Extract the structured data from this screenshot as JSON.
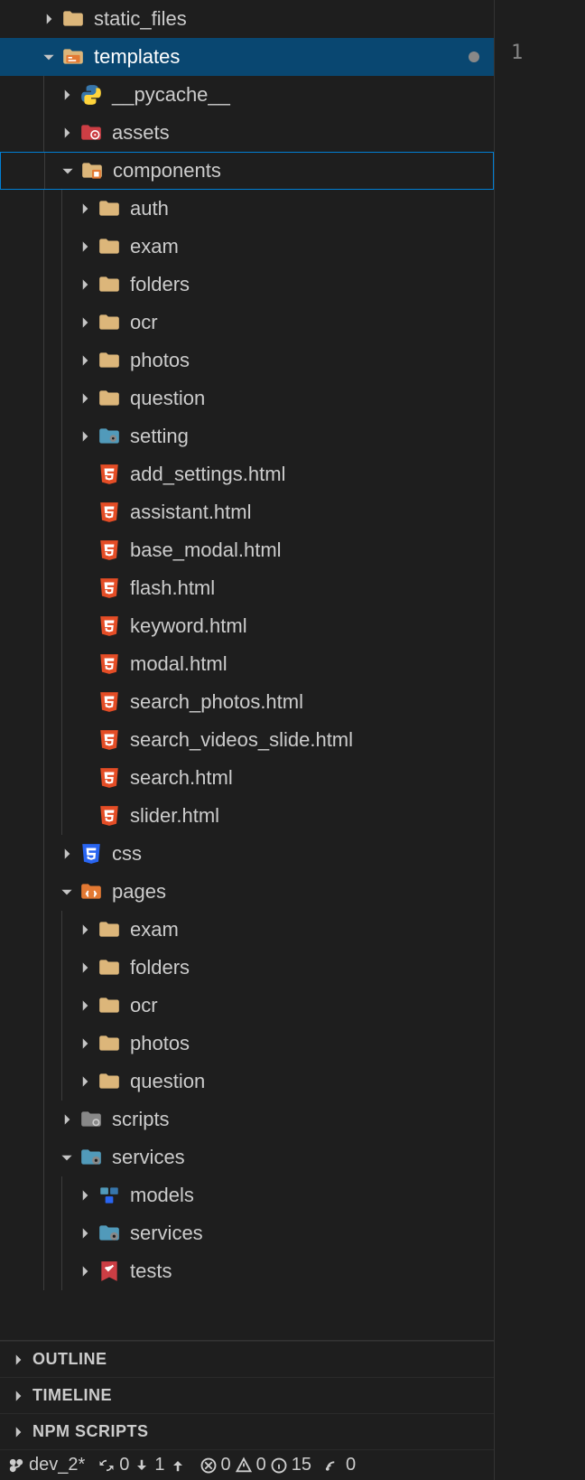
{
  "tree": {
    "static_files": "static_files",
    "templates": "templates",
    "pycache": "__pycache__",
    "assets": "assets",
    "components": "components",
    "auth": "auth",
    "exam": "exam",
    "folders": "folders",
    "ocr": "ocr",
    "photos": "photos",
    "question": "question",
    "setting": "setting",
    "files": {
      "add_settings": "add_settings.html",
      "assistant": "assistant.html",
      "base_modal": "base_modal.html",
      "flash": "flash.html",
      "keyword": "keyword.html",
      "modal": "modal.html",
      "search_photos": "search_photos.html",
      "search_videos_slide": "search_videos_slide.html",
      "search": "search.html",
      "slider": "slider.html"
    },
    "css": "css",
    "pages": "pages",
    "pages_children": {
      "exam": "exam",
      "folders": "folders",
      "ocr": "ocr",
      "photos": "photos",
      "question": "question"
    },
    "scripts": "scripts",
    "services": "services",
    "services_children": {
      "models": "models",
      "services": "services",
      "tests": "tests"
    }
  },
  "panels": {
    "outline": "OUTLINE",
    "timeline": "TIMELINE",
    "npm": "NPM SCRIPTS"
  },
  "status": {
    "branch": "dev_2*",
    "sync_down": "0",
    "sync_up": "1",
    "errors": "0",
    "warnings": "0",
    "info": "15",
    "ports": "0"
  },
  "editor": {
    "line1": "1"
  }
}
